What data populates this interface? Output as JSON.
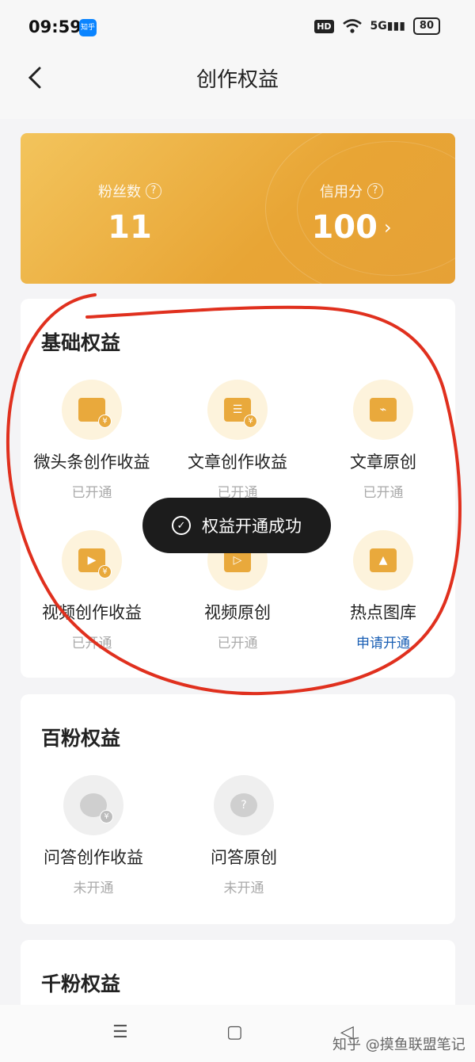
{
  "status_bar": {
    "time": "09:59",
    "app_badge": "知乎",
    "hd": "HD",
    "signal": "5G",
    "battery": "80"
  },
  "header": {
    "title": "创作权益"
  },
  "hero": {
    "fans_label": "粉丝数",
    "fans_value": "11",
    "credit_label": "信用分",
    "credit_value": "100"
  },
  "sections": {
    "basic": {
      "title": "基础权益",
      "items": [
        {
          "name": "微头条创作收益",
          "status": "已开通",
          "icon": "micro-headline-income-icon"
        },
        {
          "name": "文章创作收益",
          "status": "已开通",
          "icon": "article-income-icon"
        },
        {
          "name": "文章原创",
          "status": "已开通",
          "icon": "article-original-icon"
        },
        {
          "name": "视频创作收益",
          "status": "已开通",
          "icon": "video-income-icon"
        },
        {
          "name": "视频原创",
          "status": "已开通",
          "icon": "video-original-icon"
        },
        {
          "name": "热点图库",
          "status": "申请开通",
          "icon": "hot-gallery-icon"
        }
      ]
    },
    "hundred_fans": {
      "title": "百粉权益",
      "items": [
        {
          "name": "问答创作收益",
          "status": "未开通",
          "icon": "qa-income-icon"
        },
        {
          "name": "问答原创",
          "status": "未开通",
          "icon": "qa-original-icon"
        }
      ]
    },
    "thousand_fans": {
      "title": "千粉权益"
    }
  },
  "toast": {
    "text": "权益开通成功"
  },
  "watermark": "知乎 @摸鱼联盟笔记",
  "colors": {
    "hero_gold": "#e9a93c",
    "link_blue": "#1a5fb4",
    "annotation_red": "#e0301e"
  }
}
